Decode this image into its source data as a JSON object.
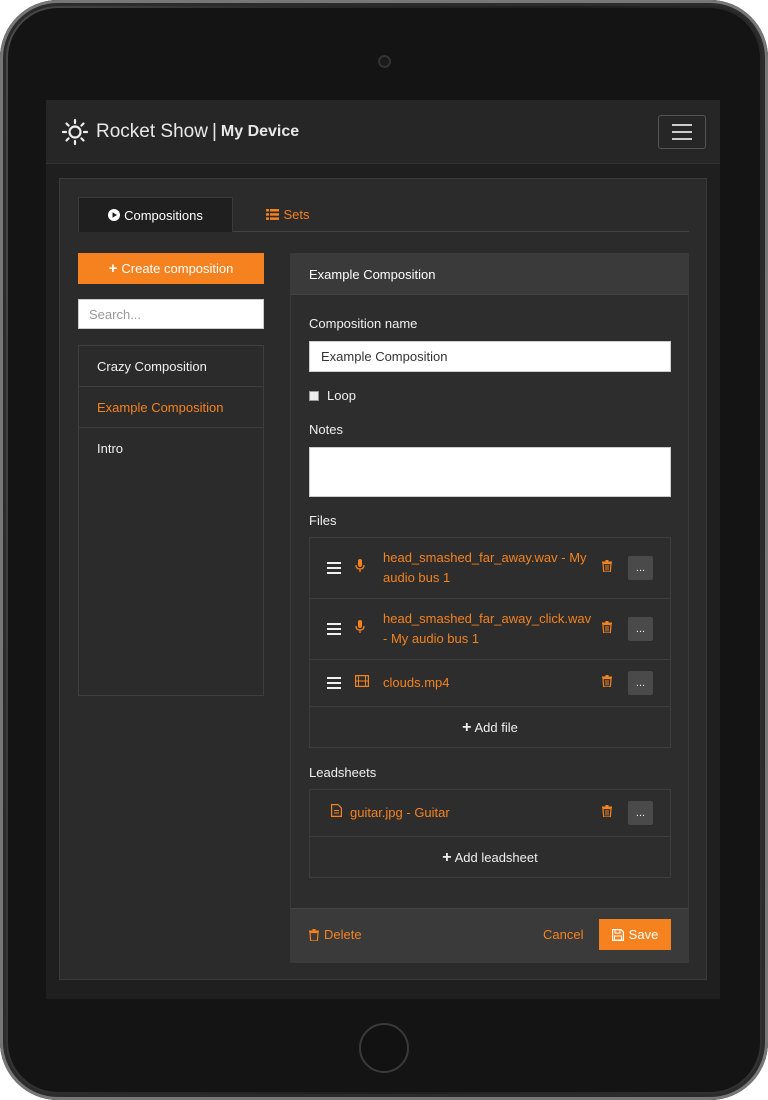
{
  "navbar": {
    "brand": "Rocket Show",
    "separator": "|",
    "device": "My Device",
    "logo_icon": "sun-icon",
    "menu_icon": "hamburger-icon"
  },
  "tabs": [
    {
      "label": "Compositions",
      "icon": "play-circle-icon",
      "active": true
    },
    {
      "label": "Sets",
      "icon": "list-icon",
      "active": false
    }
  ],
  "sidebar": {
    "create_label": "Create composition",
    "search_placeholder": "Search...",
    "compositions": [
      {
        "label": "Crazy Composition",
        "active": false
      },
      {
        "label": "Example Composition",
        "active": true
      },
      {
        "label": "Intro",
        "active": false
      }
    ]
  },
  "editor": {
    "header": "Example Composition",
    "name_label": "Composition name",
    "name_value": "Example Composition",
    "loop_label": "Loop",
    "loop_checked": false,
    "notes_label": "Notes",
    "notes_value": "",
    "files_label": "Files",
    "files": [
      {
        "name": "head_smashed_far_away.wav - My audio bus 1",
        "icon": "microphone-icon"
      },
      {
        "name": "head_smashed_far_away_click.wav - My audio bus 1",
        "icon": "microphone-icon"
      },
      {
        "name": "clouds.mp4",
        "icon": "film-icon"
      }
    ],
    "more_label": "...",
    "add_file_label": "Add file",
    "leadsheets_label": "Leadsheets",
    "leadsheets": [
      {
        "name": "guitar.jpg - Guitar",
        "icon": "file-icon"
      }
    ],
    "add_leadsheet_label": "Add leadsheet",
    "delete_label": "Delete",
    "cancel_label": "Cancel",
    "save_label": "Save"
  },
  "colors": {
    "accent": "#f5821f",
    "background": "#2b2b2b",
    "navbar": "#262626"
  }
}
